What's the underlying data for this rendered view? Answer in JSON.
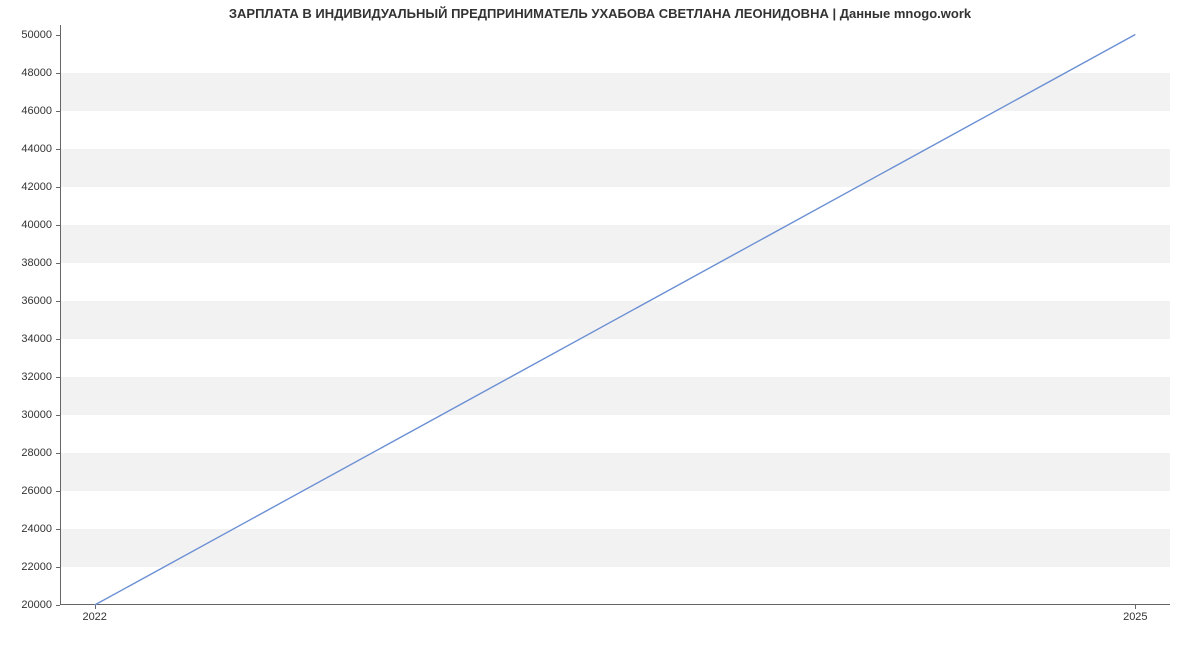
{
  "chart_data": {
    "type": "line",
    "title": "ЗАРПЛАТА В ИНДИВИДУАЛЬНЫЙ ПРЕДПРИНИМАТЕЛЬ УХАБОВА СВЕТЛАНА ЛЕОНИДОВНА | Данные mnogo.work",
    "xlabel": "",
    "ylabel": "",
    "x": [
      2022,
      2025
    ],
    "values": [
      20000,
      50000
    ],
    "y_ticks": [
      20000,
      22000,
      24000,
      26000,
      28000,
      30000,
      32000,
      34000,
      36000,
      38000,
      40000,
      42000,
      44000,
      46000,
      48000,
      50000
    ],
    "x_ticks": [
      2022,
      2025
    ],
    "xlim": [
      2021.9,
      2025.1
    ],
    "ylim": [
      20000,
      50500
    ],
    "line_color": "#6b8fd4"
  }
}
